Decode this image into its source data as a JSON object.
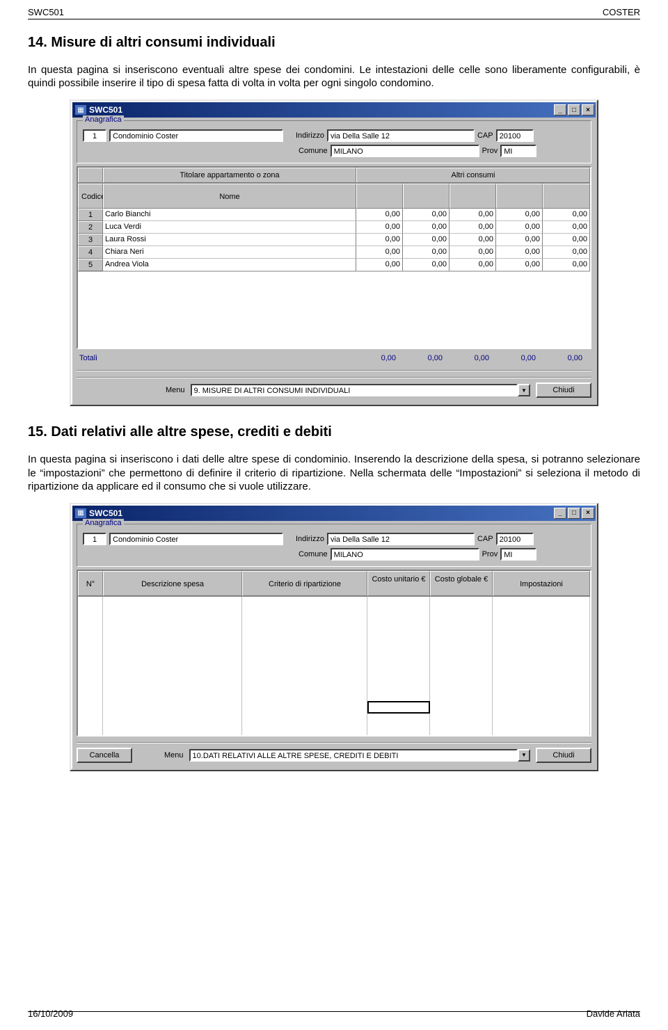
{
  "header": {
    "left": "SWC501",
    "right": "COSTER"
  },
  "sec14": {
    "title": "14. Misure di altri consumi individuali",
    "para": "In questa pagina si inseriscono eventuali altre spese dei condomini. Le intestazioni delle celle sono liberamente configurabili, è quindi possibile inserire il tipo di spesa fatta di volta in volta per ogni singolo condomino."
  },
  "win1": {
    "title": "SWC501",
    "anag_label": "Anagrafica",
    "id_field": "1",
    "condo_name": "Condominio Coster",
    "indirizzo_lbl": "Indirizzo",
    "indirizzo_val": "via Della Salle 12",
    "cap_lbl": "CAP",
    "cap_val": "20100",
    "comune_lbl": "Comune",
    "comune_val": "MILANO",
    "prov_lbl": "Prov",
    "prov_val": "MI",
    "tophead1": "Titolare appartamento o zona",
    "tophead2": "Altri consumi",
    "col_codice": "Codice",
    "col_nome": "Nome",
    "rows": [
      {
        "idx": "1",
        "nome": "Carlo Bianchi",
        "v": [
          "0,00",
          "0,00",
          "0,00",
          "0,00",
          "0,00"
        ]
      },
      {
        "idx": "2",
        "nome": "Luca Verdi",
        "v": [
          "0,00",
          "0,00",
          "0,00",
          "0,00",
          "0,00"
        ]
      },
      {
        "idx": "3",
        "nome": "Laura Rossi",
        "v": [
          "0,00",
          "0,00",
          "0,00",
          "0,00",
          "0,00"
        ]
      },
      {
        "idx": "4",
        "nome": "Chiara Neri",
        "v": [
          "0,00",
          "0,00",
          "0,00",
          "0,00",
          "0,00"
        ]
      },
      {
        "idx": "5",
        "nome": "Andrea Viola",
        "v": [
          "0,00",
          "0,00",
          "0,00",
          "0,00",
          "0,00"
        ]
      }
    ],
    "totali_lbl": "Totali",
    "totali": [
      "0,00",
      "0,00",
      "0,00",
      "0,00",
      "0,00"
    ],
    "menu_lbl": "Menu",
    "menu_val": "9. MISURE DI ALTRI CONSUMI INDIVIDUALI",
    "chiudi": "Chiudi"
  },
  "sec15": {
    "title": "15. Dati relativi alle altre spese, crediti e debiti",
    "para": "In questa pagina si inseriscono i dati delle altre spese di condominio. Inserendo la descrizione della spesa, si potranno selezionare le “impostazioni” che permettono di definire il criterio di ripartizione. Nella schermata delle “Impostazioni” si seleziona il metodo di ripartizione da applicare ed il consumo che si vuole utilizzare."
  },
  "win2": {
    "title": "SWC501",
    "anag_label": "Anagrafica",
    "id_field": "1",
    "condo_name": "Condominio Coster",
    "indirizzo_lbl": "Indirizzo",
    "indirizzo_val": "via Della Salle 12",
    "cap_lbl": "CAP",
    "cap_val": "20100",
    "comune_lbl": "Comune",
    "comune_val": "MILANO",
    "prov_lbl": "Prov",
    "prov_val": "MI",
    "cols": [
      "N°",
      "Descrizione spesa",
      "Criterio di ripartizione",
      "Costo unitario €",
      "Costo globale €",
      "Impostazioni"
    ],
    "cancella": "Cancella",
    "menu_lbl": "Menu",
    "menu_val": "10.DATI RELATIVI ALLE ALTRE SPESE, CREDITI E DEBITI",
    "chiudi": "Chiudi"
  },
  "footer": {
    "left": "16/10/2009",
    "right": "Davide Ariata"
  }
}
